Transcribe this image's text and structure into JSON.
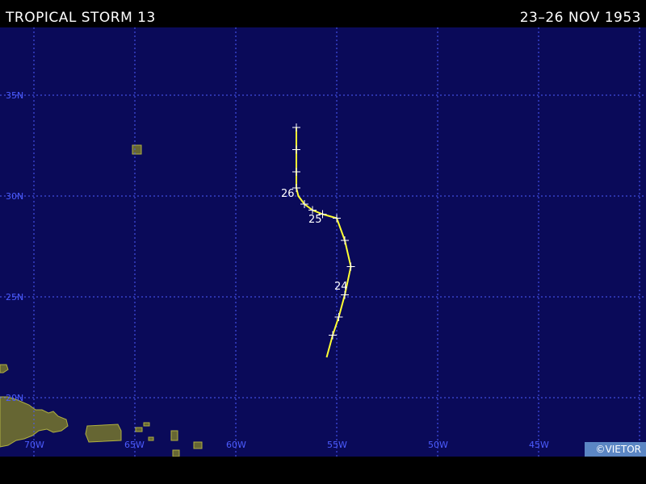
{
  "header": {
    "storm_name": "TROPICAL STORM 13",
    "date_range": "23–26 NOV 1953"
  },
  "map": {
    "ocean_color": "#0a0a59",
    "land_color": "#666633",
    "coast_color": "#b0b040",
    "grid_color": "#4c5cff",
    "track_color": "#ffff33",
    "lat_labels": [
      "35N",
      "30N",
      "25N",
      "20N"
    ],
    "lon_labels": [
      "70W",
      "65W",
      "60W",
      "55W",
      "50W",
      "45W"
    ],
    "day_labels": [
      "26",
      "25",
      "24"
    ],
    "credit": "©VIETOR"
  },
  "track": {
    "points": [
      [
        -55.5,
        22.0
      ],
      [
        -55.2,
        23.1
      ],
      [
        -54.9,
        24.0
      ],
      [
        -54.6,
        25.1
      ],
      [
        -54.3,
        26.5
      ],
      [
        -54.6,
        27.8
      ],
      [
        -55.0,
        28.9
      ],
      [
        -55.7,
        29.1
      ],
      [
        -56.2,
        29.3
      ],
      [
        -56.6,
        29.6
      ],
      [
        -56.9,
        30.0
      ],
      [
        -57.0,
        30.4
      ],
      [
        -57.0,
        31.2
      ],
      [
        -57.0,
        32.3
      ],
      [
        -57.0,
        33.4
      ]
    ],
    "ticks": [
      [
        -55.2,
        23.1
      ],
      [
        -54.9,
        24.0
      ],
      [
        -54.6,
        25.1
      ],
      [
        -54.3,
        26.5
      ],
      [
        -54.6,
        27.8
      ],
      [
        -55.0,
        28.9
      ],
      [
        -55.7,
        29.1
      ],
      [
        -56.2,
        29.3
      ],
      [
        -56.6,
        29.6
      ],
      [
        -57.0,
        30.4
      ],
      [
        -57.0,
        31.2
      ],
      [
        -57.0,
        32.3
      ],
      [
        -57.0,
        33.4
      ]
    ]
  }
}
